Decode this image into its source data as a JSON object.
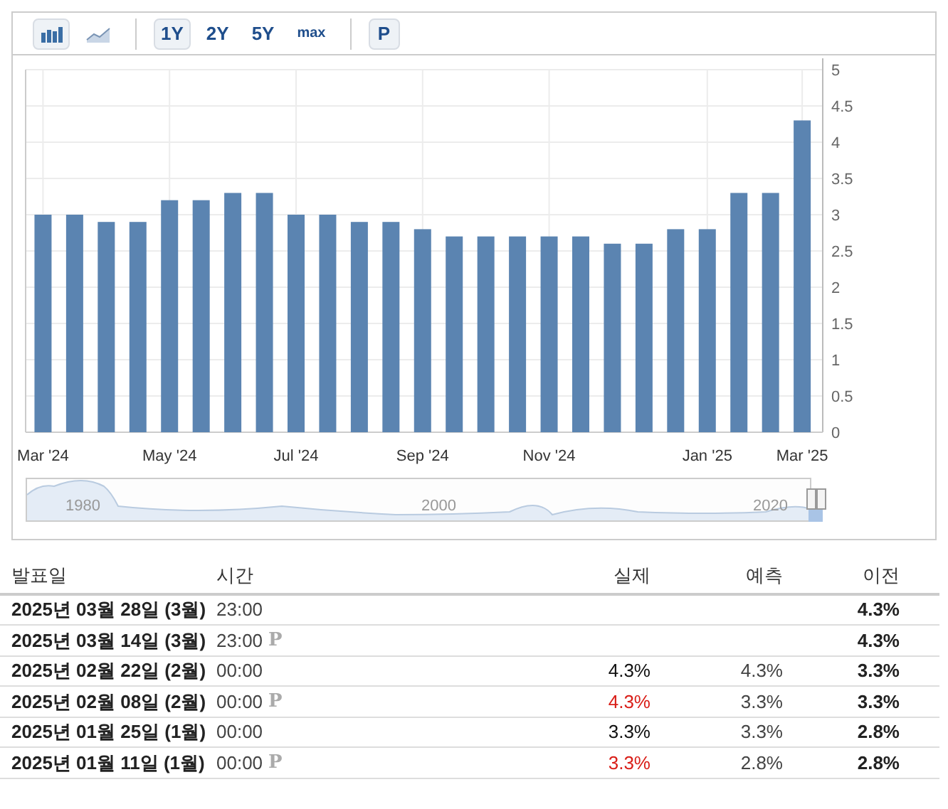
{
  "toolbar": {
    "chart_types": [
      {
        "kind": "bar",
        "selected": true
      },
      {
        "kind": "line",
        "selected": false
      }
    ],
    "ranges": [
      {
        "label": "1Y",
        "selected": true
      },
      {
        "label": "2Y",
        "selected": false
      },
      {
        "label": "5Y",
        "selected": false
      },
      {
        "label": "max",
        "selected": false
      }
    ],
    "preliminary": {
      "label": "P",
      "selected": true
    }
  },
  "chart": {
    "chart_data": {
      "type": "bar",
      "categories": [
        "Mar '24",
        null,
        null,
        null,
        "May '24",
        null,
        null,
        null,
        "Jul '24",
        null,
        null,
        null,
        "Sep '24",
        null,
        null,
        null,
        "Nov '24",
        null,
        null,
        null,
        null,
        "Jan '25",
        null,
        null,
        "Mar '25"
      ],
      "series": [
        {
          "color": "#5b84b1",
          "values": [
            3.0,
            3.0,
            2.9,
            2.9,
            3.2,
            3.2,
            3.3,
            3.3,
            3.0,
            3.0,
            2.9,
            2.9,
            2.8,
            2.7,
            2.7,
            2.7,
            2.7,
            2.7,
            2.6,
            2.6,
            2.8,
            2.8,
            3.3,
            3.3,
            4.3
          ]
        }
      ],
      "ylim": [
        0,
        5
      ],
      "grid": true,
      "yticks": [
        0,
        {
          "value": 0.5,
          "label": "0.5"
        },
        {
          "value": 1,
          "label": "1"
        },
        {
          "value": 1.5,
          "label": "1.5"
        },
        {
          "value": 2,
          "label": "2"
        },
        {
          "value": 2.5,
          "label": "2.5"
        },
        {
          "value": 3,
          "label": "3"
        },
        {
          "value": 3.5,
          "label": "3.5"
        },
        {
          "value": 4,
          "label": "4"
        },
        {
          "value": 4.5,
          "label": "4.5"
        },
        {
          "value": 5,
          "label": "5"
        }
      ]
    },
    "navigator_labels": [
      "1980",
      "2000",
      "2020"
    ]
  },
  "table": {
    "columns": [
      "발표일",
      "시간",
      "실제",
      "예측",
      "이전"
    ],
    "rows": [
      {
        "date": "2025년 03월 28일 (3월)",
        "time": "23:00",
        "previous": "4.3%"
      },
      {
        "date": "2025년 03월 14일 (3월)",
        "time": "23:00",
        "mark": "P",
        "previous": "4.3%"
      },
      {
        "date": "2025년 02월 22일 (2월)",
        "time": "00:00",
        "actual": {
          "text": "4.3%",
          "color": "#111111"
        },
        "forecast": "4.3%",
        "previous": "3.3%"
      },
      {
        "date": "2025년 02월 08일 (2월)",
        "time": "00:00",
        "mark": "P",
        "actual": {
          "text": "4.3%",
          "color": "#d91e18"
        },
        "forecast": "3.3%",
        "previous": "3.3%"
      },
      {
        "date": "2025년 01월 25일 (1월)",
        "time": "00:00",
        "actual": {
          "text": "3.3%",
          "color": "#111111"
        },
        "forecast": "3.3%",
        "previous": "2.8%"
      },
      {
        "date": "2025년 01월 11일 (1월)",
        "time": "00:00",
        "mark": "P",
        "actual": {
          "text": "3.3%",
          "color": "#d91e18"
        },
        "forecast": "2.8%",
        "previous": "2.8%"
      }
    ]
  }
}
